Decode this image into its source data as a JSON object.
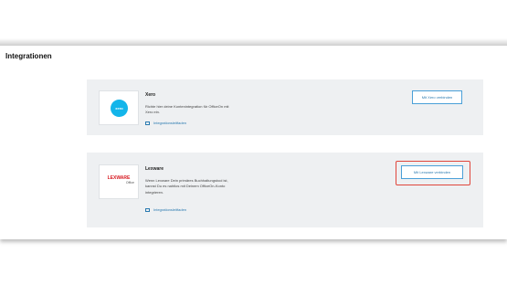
{
  "page": {
    "title": "Integrationen"
  },
  "integrations": [
    {
      "name": "Xero",
      "logo_text": "xero",
      "description": "Richte hier deine Kontenintegration für OfficeOn mit Xero ein.",
      "guide_link": "Integrationsleitfaden",
      "button_label": "Mit Xero verbinden"
    },
    {
      "name": "Lexware",
      "logo_text": "LEXWARE",
      "logo_sub": "Office",
      "description": "Wenn Lexware Dein primäres Buchhaltungstool ist, kannst Du es nahtlos mit Deinem OfficeOn-Konto integrieren.",
      "guide_link": "Integrationsleitfaden",
      "button_label": "Mit Lexware verbinden"
    }
  ],
  "colors": {
    "link": "#2a7ab0",
    "xero_brand": "#13b5ea",
    "lexware_brand": "#d71920",
    "highlight": "#e0463c",
    "card_bg": "#eef0f2"
  }
}
